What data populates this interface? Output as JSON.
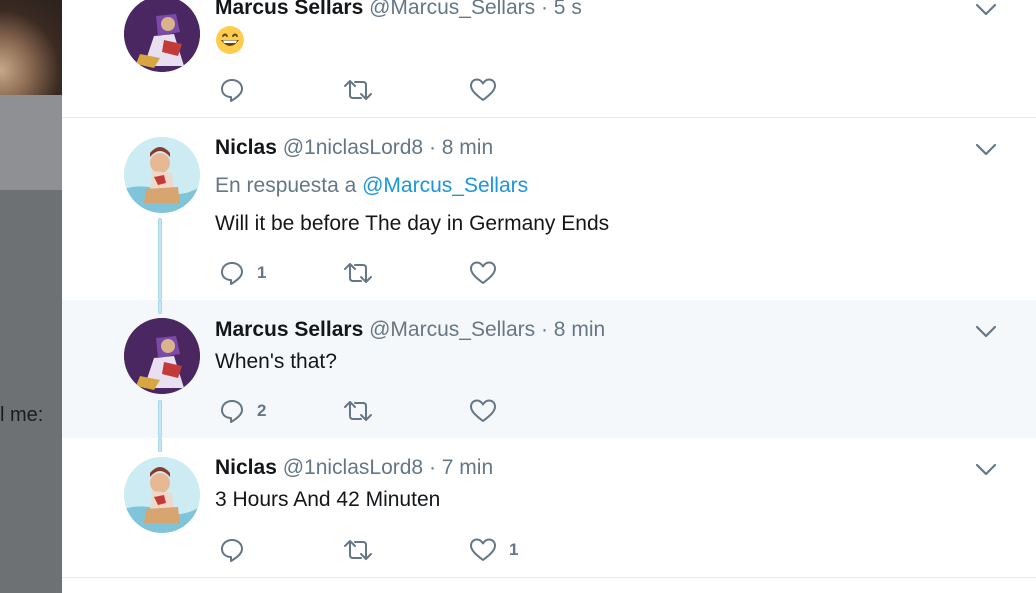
{
  "backdrop": {
    "side_text": "l me:"
  },
  "tweets": [
    {
      "name": "Marcus Sellars",
      "handle": "@Marcus_Sellars",
      "time": "· 5 s",
      "emoji": "grinning-face-emoji",
      "reply_count": "",
      "like_count": ""
    },
    {
      "name": "Niclas",
      "handle": "@1niclasLord8",
      "time": "· 8 min",
      "reply_prefix": "En respuesta a",
      "reply_mention": "@Marcus_Sellars",
      "text": "Will it be before The day in Germany Ends",
      "reply_count": "1",
      "like_count": ""
    },
    {
      "name": "Marcus Sellars",
      "handle": "@Marcus_Sellars",
      "time": "· 8 min",
      "text": "When's that?",
      "reply_count": "2",
      "like_count": ""
    },
    {
      "name": "Niclas",
      "handle": "@1niclasLord8",
      "time": "· 7 min",
      "text": "3 Hours And 42 Minuten",
      "reply_count": "",
      "like_count": "1"
    }
  ],
  "icons": {
    "reply": "reply-icon",
    "retweet": "retweet-icon",
    "like": "like-icon",
    "menu": "chevron-down-icon"
  },
  "colors": {
    "name": "#14171a",
    "meta": "#657786",
    "link": "#1b95e0",
    "highlight_bg": "#f5f8fa",
    "thread_line": "#c5e6f5"
  }
}
